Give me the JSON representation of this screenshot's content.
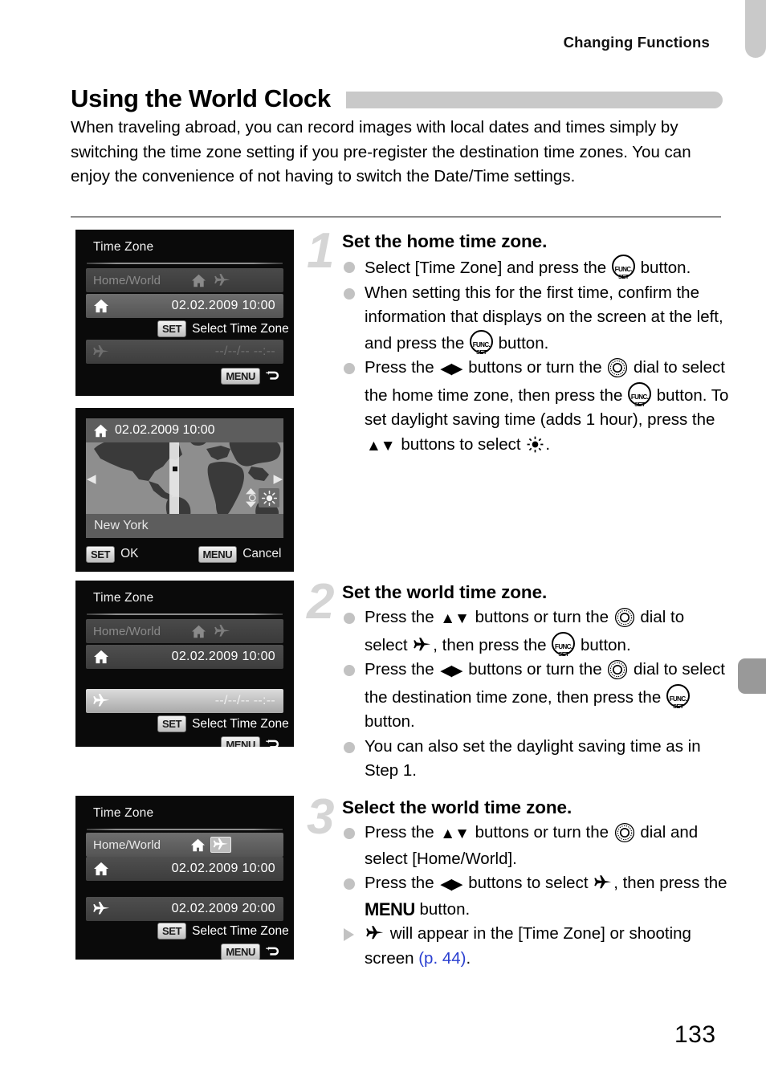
{
  "header": {
    "running_head": "Changing Functions",
    "page_number": "133"
  },
  "section": {
    "title": "Using the World Clock",
    "intro": "When traveling abroad, you can record images with local dates and times simply by switching the time zone setting if you pre-register the destination time zones. You can enjoy the convenience of not having to switch the Date/Time settings."
  },
  "screens": [
    {
      "id": "time-zone-home",
      "title": "Time Zone",
      "rows": [
        {
          "label": "Home/World",
          "icons": [
            "home-icon",
            "plane-icon"
          ]
        },
        {
          "label": "",
          "icon": "home-icon",
          "value": "02.02.2009 10:00"
        },
        {
          "label": "",
          "icon": "plane-icon",
          "value": "--/--/-- --:--"
        }
      ],
      "hint_set": "Select Time Zone",
      "hint_set_badge": "SET",
      "footer_menu_badge": "MENU",
      "footer_return": "return-arrow-icon"
    },
    {
      "id": "world-map",
      "top_icon": "home-icon",
      "top_datetime": "02.02.2009 10:00",
      "city": "New York",
      "footer_set_badge": "SET",
      "footer_set_label": "OK",
      "footer_menu_badge": "MENU",
      "footer_menu_label": "Cancel",
      "left_arrow": "left-arrow-icon",
      "right_arrow": "right-arrow-icon",
      "updown": "up-down-arrow-icon",
      "dst_icon": "sun-icon"
    },
    {
      "id": "time-zone-world",
      "title": "Time Zone",
      "rows": [
        {
          "label": "Home/World",
          "icons": [
            "home-icon",
            "plane-icon"
          ]
        },
        {
          "label": "",
          "icon": "home-icon",
          "value": "02.02.2009 10:00"
        },
        {
          "label": "",
          "icon": "plane-icon",
          "value": "--/--/-- --:--"
        }
      ],
      "hint_set": "Select Time Zone",
      "hint_set_badge": "SET",
      "footer_menu_badge": "MENU",
      "footer_return": "return-arrow-icon"
    },
    {
      "id": "time-zone-selected",
      "title": "Time Zone",
      "rows": [
        {
          "label": "Home/World",
          "icons": [
            "home-icon",
            "plane-icon-selected"
          ]
        },
        {
          "label": "",
          "icon": "home-icon",
          "value": "02.02.2009 10:00"
        },
        {
          "label": "",
          "icon": "plane-icon",
          "value": "02.02.2009 20:00"
        }
      ],
      "hint_set": "Select Time Zone",
      "hint_set_badge": "SET",
      "footer_menu_badge": "MENU",
      "footer_return": "return-arrow-icon"
    }
  ],
  "steps": [
    {
      "number": "1",
      "heading": "Set the home time zone.",
      "bullets": [
        {
          "marker": "dot",
          "parts": [
            "Select [Time Zone] and press the ",
            "FUNCSET",
            " button."
          ]
        },
        {
          "marker": "dot",
          "parts": [
            "When setting this for the first time, confirm the information that displays on the screen at the left, and press the ",
            "FUNCSET",
            " button."
          ]
        },
        {
          "marker": "dot",
          "parts": [
            "Press the ",
            "LR",
            " buttons or turn the ",
            "DIAL",
            " dial to select the home time zone, then press the ",
            "FUNCSET",
            " button. To set daylight saving time (adds 1 hour), press the ",
            "UD",
            " buttons to select ",
            "SUN",
            "."
          ]
        }
      ]
    },
    {
      "number": "2",
      "heading": "Set the world time zone.",
      "bullets": [
        {
          "marker": "dot",
          "parts": [
            "Press the ",
            "UD",
            " buttons or turn the ",
            "DIAL",
            " dial to select ",
            "PLANE",
            ", then press the ",
            "FUNCSET",
            " button."
          ]
        },
        {
          "marker": "dot",
          "parts": [
            "Press the ",
            "LR",
            " buttons or turn the ",
            "DIAL",
            " dial to select the destination time zone, then press the ",
            "FUNCSET",
            " button."
          ]
        },
        {
          "marker": "dot",
          "parts": [
            "You can also set the daylight saving time as in Step 1."
          ]
        }
      ]
    },
    {
      "number": "3",
      "heading": "Select the world time zone.",
      "bullets": [
        {
          "marker": "dot",
          "parts": [
            "Press the ",
            "UD",
            " buttons or turn the ",
            "DIAL",
            " dial and select [Home/World]."
          ]
        },
        {
          "marker": "dot",
          "parts": [
            "Press the ",
            "LR",
            " buttons to select ",
            "PLANE",
            ", then press the ",
            "MENU",
            " button."
          ]
        },
        {
          "marker": "tri",
          "parts": [
            "PLANE",
            " will appear in the [Time Zone] or shooting screen ",
            "REF:(p. 44)",
            "."
          ]
        }
      ]
    }
  ],
  "colors": {
    "accent_gray": "#c9c9c9",
    "tab_gray": "#999999",
    "link_blue": "#2a3fd0"
  }
}
